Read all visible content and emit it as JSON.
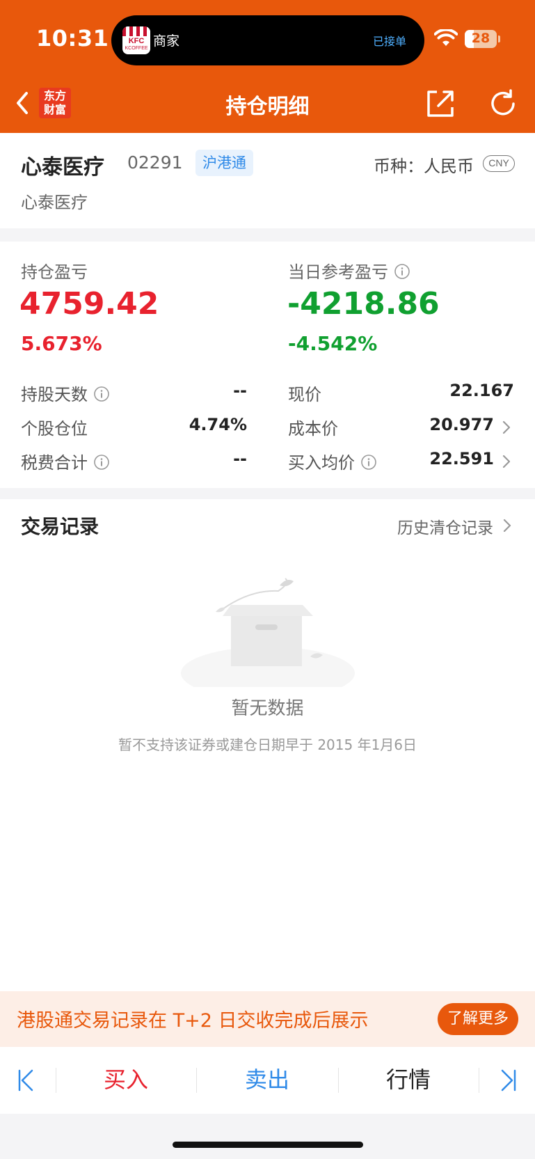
{
  "status_bar": {
    "time": "10:31",
    "island_merchant": "商家",
    "island_status": "已接单",
    "island_logo_text": "KFC",
    "island_logo_sub": "KCOFFEE",
    "battery": "28",
    "battery_level": 0.28
  },
  "header": {
    "title": "持仓明细",
    "brand_line1": "东方",
    "brand_line2": "财富",
    "icons": [
      "back-icon",
      "share-icon",
      "refresh-icon"
    ]
  },
  "stock": {
    "name": "心泰医疗",
    "code": "02291",
    "market": "沪港通",
    "currency_label": "币种：人民币",
    "currency_code": "CNY",
    "subtitle": "心泰医疗"
  },
  "pl": {
    "holding_label": "持仓盈亏",
    "holding_value": "4759.42",
    "holding_pct": "5.673%",
    "daily_label": "当日参考盈亏",
    "daily_value": "-4218.86",
    "daily_pct": "-4.542%",
    "rows_left": [
      {
        "label": "持股天数",
        "value": "--",
        "info": true
      },
      {
        "label": "个股仓位",
        "value": "4.74%",
        "info": false
      },
      {
        "label": "税费合计",
        "value": "--",
        "info": true
      }
    ],
    "rows_right": [
      {
        "label": "现价",
        "value": "22.167",
        "info": false,
        "arrow": false
      },
      {
        "label": "成本价",
        "value": "20.977",
        "info": false,
        "arrow": true
      },
      {
        "label": "买入均价",
        "value": "22.591",
        "info": true,
        "arrow": true
      }
    ],
    "colors": {
      "gain": "#e8222e",
      "loss": "#10a030"
    }
  },
  "trades": {
    "title": "交易记录",
    "history_link": "历史清仓记录",
    "empty_title": "暂无数据",
    "empty_desc": "暂不支持该证券或建仓日期早于 2015 年1月6日"
  },
  "notice": {
    "text": "港股通交易记录在 T+2 日交收完成后展示",
    "button": "了解更多"
  },
  "tabbar": {
    "buy": "买入",
    "sell": "卖出",
    "quote": "行情"
  }
}
